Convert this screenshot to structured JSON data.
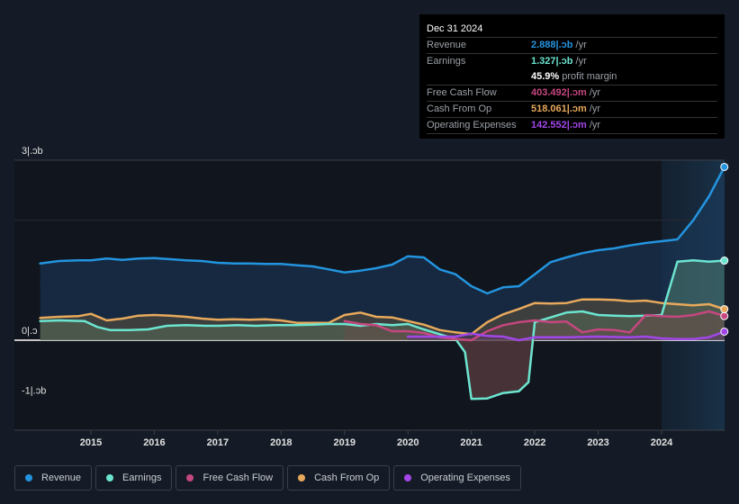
{
  "tooltip": {
    "date": "Dec 31 2024",
    "rows": [
      {
        "label": "Revenue",
        "value": "2.888|.ɔb",
        "unit": " /yr",
        "color": "#2394df"
      },
      {
        "label": "Earnings",
        "value": "1.327|.ɔb",
        "unit": " /yr",
        "color": "#6ce5d0"
      },
      {
        "label": "",
        "value": "45.9%",
        "unit": " profit margin",
        "color": "#ffffff"
      },
      {
        "label": "Free Cash Flow",
        "value": "403.492|.ɔm",
        "unit": " /yr",
        "color": "#c5477f"
      },
      {
        "label": "Cash From Op",
        "value": "518.061|.ɔm",
        "unit": " /yr",
        "color": "#e8a95c"
      },
      {
        "label": "Operating Expenses",
        "value": "142.552|.ɔm",
        "unit": " /yr",
        "color": "#a246e8"
      }
    ]
  },
  "legend": [
    {
      "label": "Revenue",
      "color": "#2394df"
    },
    {
      "label": "Earnings",
      "color": "#6ce5d0"
    },
    {
      "label": "Free Cash Flow",
      "color": "#c5477f"
    },
    {
      "label": "Cash From Op",
      "color": "#e8a95c"
    },
    {
      "label": "Operating Expenses",
      "color": "#a246e8"
    }
  ],
  "chart_data": {
    "type": "line",
    "title": "",
    "xlabel": "",
    "ylabel": "",
    "ylim": [
      -1.5,
      3
    ],
    "xlim": [
      2013.5,
      2025
    ],
    "y_ticks": [
      {
        "value": 3,
        "label": "3|.ɔb"
      },
      {
        "value": 0,
        "label": "0|.ɔ"
      },
      {
        "value": -1,
        "label": "-1|.ɔb"
      }
    ],
    "x_ticks": [
      "2015",
      "2016",
      "2017",
      "2018",
      "2019",
      "2020",
      "2021",
      "2022",
      "2023",
      "2024"
    ],
    "highlight_start": 2024.0,
    "grid": true,
    "legend_position": "bottom-left",
    "series": [
      {
        "name": "Revenue",
        "color": "#2394df",
        "x": [
          2014.2,
          2014.5,
          2014.8,
          2015.0,
          2015.25,
          2015.5,
          2015.75,
          2016.0,
          2016.25,
          2016.5,
          2016.75,
          2017.0,
          2017.25,
          2017.5,
          2017.75,
          2018.0,
          2018.25,
          2018.5,
          2018.75,
          2019.0,
          2019.25,
          2019.5,
          2019.75,
          2020.0,
          2020.25,
          2020.5,
          2020.75,
          2021.0,
          2021.25,
          2021.5,
          2021.75,
          2022.0,
          2022.25,
          2022.5,
          2022.75,
          2023.0,
          2023.25,
          2023.5,
          2023.75,
          2024.0,
          2024.25,
          2024.5,
          2024.75,
          2024.99
        ],
        "values": [
          1.28,
          1.32,
          1.33,
          1.33,
          1.36,
          1.34,
          1.36,
          1.37,
          1.35,
          1.33,
          1.32,
          1.29,
          1.28,
          1.28,
          1.27,
          1.27,
          1.25,
          1.23,
          1.18,
          1.13,
          1.16,
          1.2,
          1.26,
          1.4,
          1.38,
          1.18,
          1.1,
          0.9,
          0.78,
          0.88,
          0.9,
          1.1,
          1.3,
          1.38,
          1.45,
          1.5,
          1.53,
          1.58,
          1.62,
          1.65,
          1.68,
          2.0,
          2.4,
          2.888
        ]
      },
      {
        "name": "Earnings",
        "color": "#6ce5d0",
        "x": [
          2014.2,
          2014.5,
          2014.9,
          2015.1,
          2015.3,
          2015.6,
          2015.9,
          2016.2,
          2016.5,
          2016.8,
          2017.0,
          2017.3,
          2017.6,
          2017.9,
          2018.2,
          2018.5,
          2018.75,
          2019.0,
          2019.25,
          2019.5,
          2019.75,
          2020.0,
          2020.25,
          2020.5,
          2020.75,
          2020.9,
          2021.0,
          2021.25,
          2021.5,
          2021.75,
          2021.9,
          2022.0,
          2022.25,
          2022.5,
          2022.75,
          2023.0,
          2023.25,
          2023.5,
          2023.75,
          2024.0,
          2024.25,
          2024.5,
          2024.75,
          2024.99
        ],
        "values": [
          0.32,
          0.33,
          0.32,
          0.22,
          0.17,
          0.17,
          0.18,
          0.24,
          0.25,
          0.24,
          0.24,
          0.25,
          0.24,
          0.25,
          0.25,
          0.26,
          0.27,
          0.27,
          0.24,
          0.27,
          0.25,
          0.27,
          0.18,
          0.1,
          0.02,
          -0.2,
          -0.98,
          -0.97,
          -0.88,
          -0.85,
          -0.7,
          0.3,
          0.38,
          0.46,
          0.48,
          0.42,
          0.41,
          0.4,
          0.41,
          0.42,
          1.31,
          1.33,
          1.31,
          1.327
        ]
      },
      {
        "name": "Free Cash Flow",
        "color": "#c5477f",
        "x": [
          2019.0,
          2019.25,
          2019.5,
          2019.75,
          2020.0,
          2020.25,
          2020.5,
          2020.75,
          2021.0,
          2021.25,
          2021.5,
          2021.75,
          2022.0,
          2022.25,
          2022.5,
          2022.75,
          2023.0,
          2023.25,
          2023.5,
          2023.75,
          2024.0,
          2024.25,
          2024.5,
          2024.75,
          2024.99
        ],
        "values": [
          0.32,
          0.27,
          0.25,
          0.15,
          0.15,
          0.12,
          0.05,
          0.02,
          0.0,
          0.15,
          0.25,
          0.3,
          0.33,
          0.3,
          0.31,
          0.13,
          0.18,
          0.17,
          0.13,
          0.42,
          0.4,
          0.39,
          0.42,
          0.48,
          0.403
        ]
      },
      {
        "name": "Cash From Op",
        "color": "#e8a95c",
        "x": [
          2014.2,
          2014.5,
          2014.8,
          2015.0,
          2015.25,
          2015.5,
          2015.75,
          2016.0,
          2016.25,
          2016.5,
          2016.75,
          2017.0,
          2017.25,
          2017.5,
          2017.75,
          2018.0,
          2018.25,
          2018.5,
          2018.75,
          2019.0,
          2019.25,
          2019.5,
          2019.75,
          2020.0,
          2020.25,
          2020.5,
          2020.75,
          2021.0,
          2021.25,
          2021.5,
          2021.75,
          2022.0,
          2022.25,
          2022.5,
          2022.75,
          2023.0,
          2023.25,
          2023.5,
          2023.75,
          2024.0,
          2024.25,
          2024.5,
          2024.75,
          2024.99
        ],
        "values": [
          0.37,
          0.39,
          0.4,
          0.44,
          0.33,
          0.36,
          0.41,
          0.42,
          0.41,
          0.39,
          0.36,
          0.34,
          0.35,
          0.34,
          0.35,
          0.33,
          0.29,
          0.29,
          0.29,
          0.42,
          0.46,
          0.39,
          0.38,
          0.32,
          0.26,
          0.17,
          0.13,
          0.1,
          0.3,
          0.43,
          0.52,
          0.62,
          0.61,
          0.62,
          0.68,
          0.68,
          0.67,
          0.65,
          0.66,
          0.62,
          0.6,
          0.58,
          0.6,
          0.518
        ]
      },
      {
        "name": "Operating Expenses",
        "color": "#a246e8",
        "x": [
          2020.0,
          2020.25,
          2020.5,
          2020.75,
          2021.0,
          2021.25,
          2021.5,
          2021.75,
          2022.0,
          2022.5,
          2023.0,
          2023.5,
          2023.75,
          2024.0,
          2024.25,
          2024.5,
          2024.75,
          2024.99
        ],
        "values": [
          0.06,
          0.06,
          0.06,
          0.06,
          0.11,
          0.07,
          0.06,
          0.0,
          0.05,
          0.05,
          0.06,
          0.05,
          0.06,
          0.03,
          0.02,
          0.02,
          0.05,
          0.143
        ]
      }
    ]
  }
}
